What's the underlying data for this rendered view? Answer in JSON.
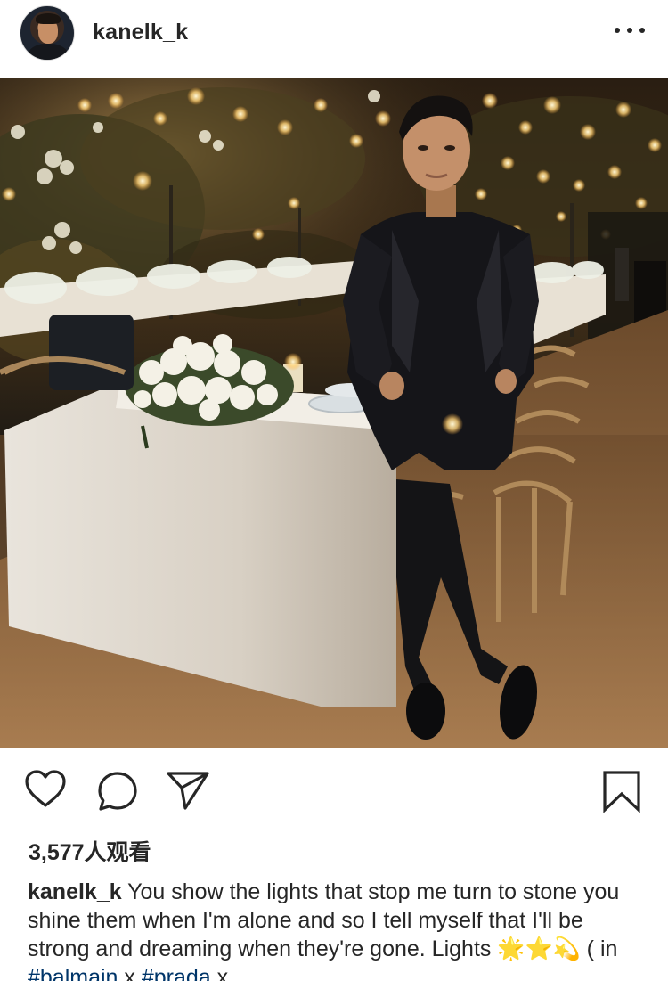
{
  "post": {
    "username": "kanelk_k",
    "views": "3,577人观看",
    "caption": {
      "user": "kanelk_k",
      "text": " You show the lights that stop me turn to stone you shine them when I'm alone and so I tell myself that I'll be strong and dreaming when they're gone. Lights ",
      "emoji": "🌟⭐💫",
      "suffix": " ( in ",
      "tag1": "#balmain",
      "joiner": " x ",
      "tag2": "#prada",
      "tail": " x"
    }
  },
  "icons": {
    "avatar": "avatar",
    "more": "more-dots-icon",
    "like": "heart-icon",
    "comment": "comment-icon",
    "share": "paper-plane-icon",
    "save": "bookmark-icon"
  },
  "colors": {
    "text": "#262626",
    "hashtag": "#003569",
    "background": "#ffffff"
  }
}
